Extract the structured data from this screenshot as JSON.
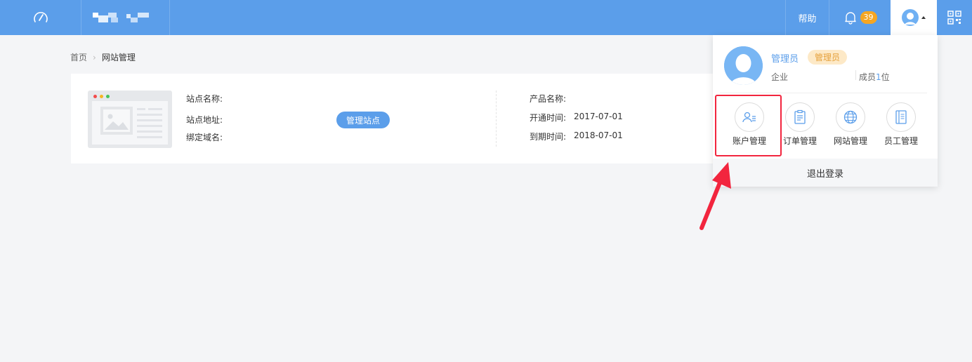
{
  "topbar": {
    "logo_icon": "speedometer-icon",
    "help_label": "帮助",
    "notification_count": "39",
    "bell_icon": "bell-icon",
    "qr_icon": "qrcode-icon",
    "accent": "#5b9eea"
  },
  "breadcrumb": {
    "home": "首页",
    "current": "网站管理"
  },
  "site": {
    "name_label": "站点名称:",
    "address_label": "站点地址:",
    "domain_label": "绑定域名:",
    "manage_button": "管理站点",
    "product_label": "产品名称:",
    "open_time_label": "开通时间:",
    "open_time": "2017-07-01",
    "expire_time_label": "到期时间:",
    "expire_time": "2018-07-01"
  },
  "user_menu": {
    "name": "管理员",
    "role": "管理员",
    "company_label": "企业",
    "members_prefix": "成员",
    "members_count": "1",
    "members_suffix": "位",
    "items": [
      {
        "label": "账户管理",
        "icon": "account-icon"
      },
      {
        "label": "订单管理",
        "icon": "order-icon"
      },
      {
        "label": "网站管理",
        "icon": "globe-icon"
      },
      {
        "label": "员工管理",
        "icon": "staff-icon"
      }
    ],
    "logout": "退出登录"
  },
  "annotation": {
    "highlight_color": "#f2253e"
  }
}
